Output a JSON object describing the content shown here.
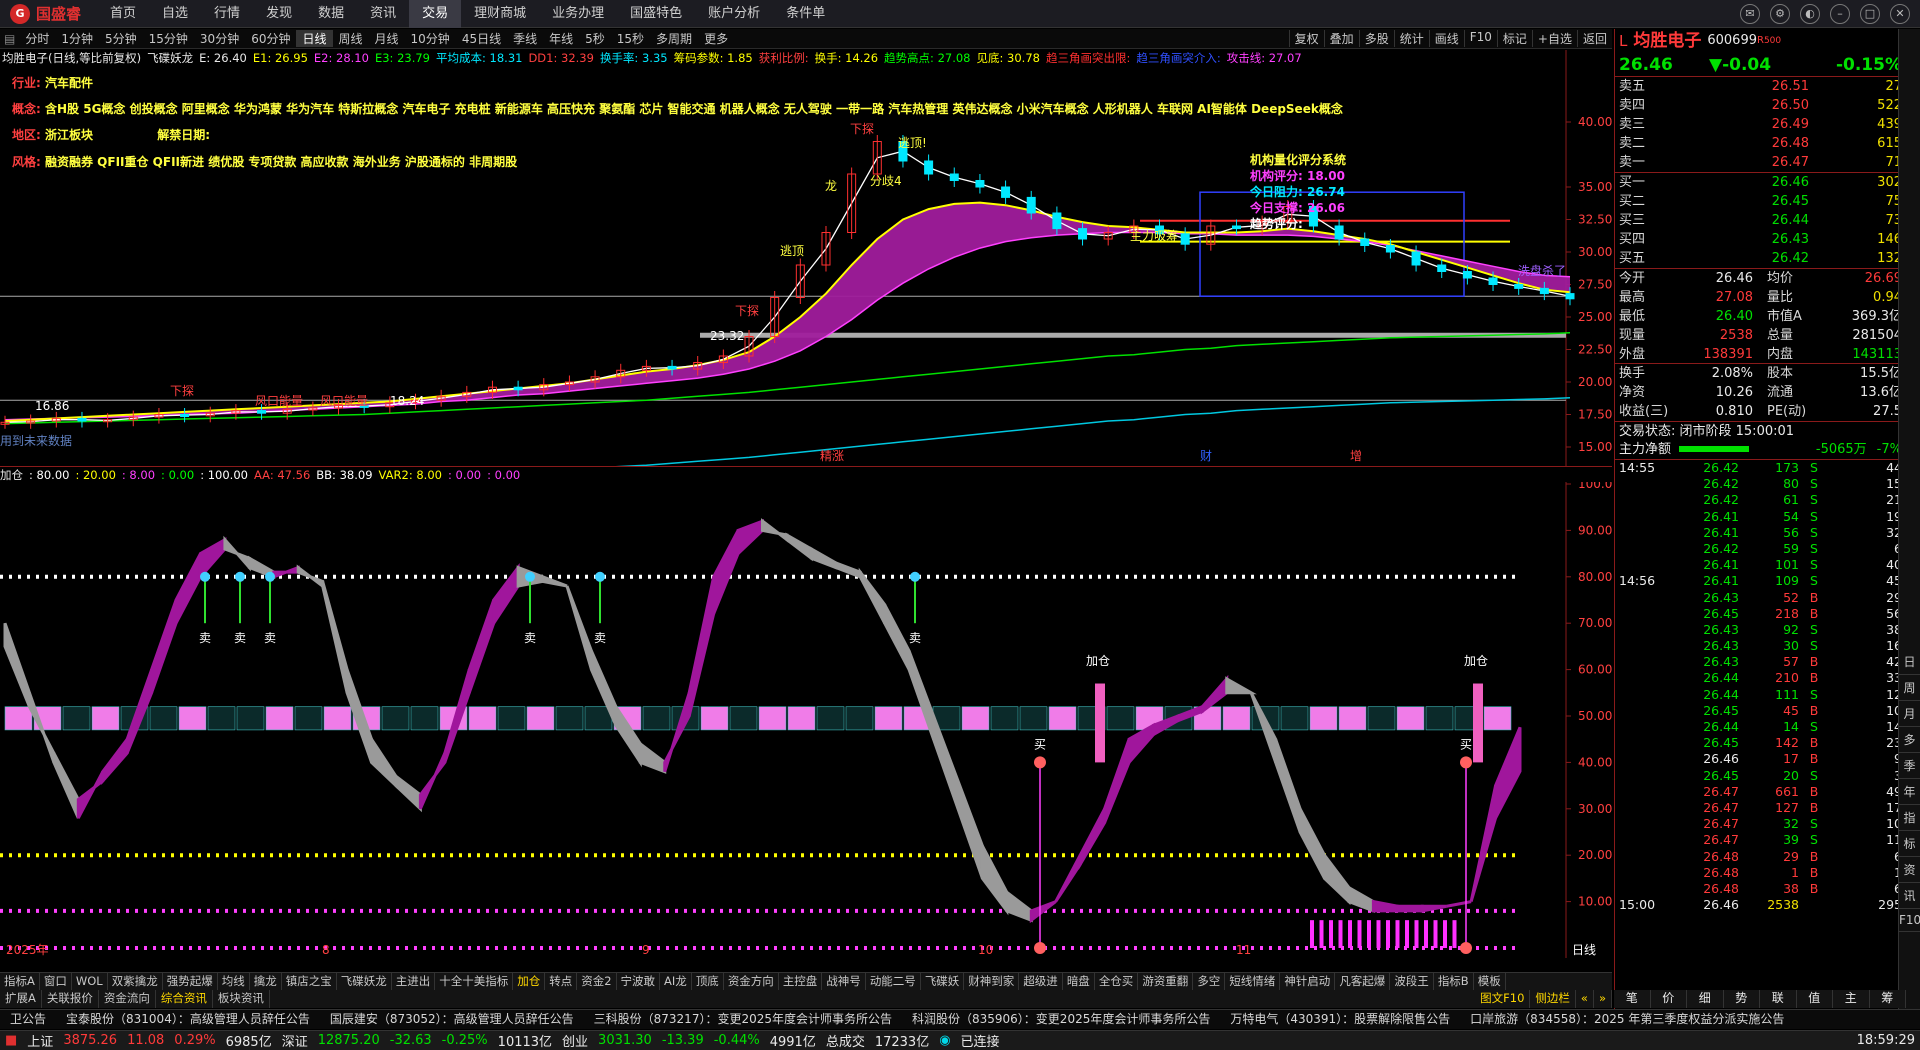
{
  "app": {
    "logo": "国盛睿",
    "logo_mark": "G"
  },
  "menu": [
    "首页",
    "自选",
    "行情",
    "发现",
    "数据",
    "资讯",
    "交易",
    "理财商城",
    "业务办理",
    "国盛特色",
    "账户分析",
    "条件单"
  ],
  "menu_active": 6,
  "periods": [
    "分时",
    "1分钟",
    "5分钟",
    "15分钟",
    "30分钟",
    "60分钟",
    "日线",
    "周线",
    "月线",
    "10分钟",
    "45日线",
    "季线",
    "年线",
    "5秒",
    "15秒",
    "多周期",
    "更多"
  ],
  "period_active": 6,
  "right_tools": [
    "复权",
    "叠加",
    "多股",
    "统计",
    "画线",
    "F10",
    "标记",
    "+自选",
    "返回"
  ],
  "indicator_line": [
    {
      "t": "均胜电子(日线,等比前复权)",
      "c": "#e8e8e8"
    },
    {
      "t": "飞碟妖龙",
      "c": "#e8e8e8"
    },
    {
      "t": "E: 26.40",
      "c": "#e8e8e8"
    },
    {
      "t": "E1: 26.95",
      "c": "#ffff00"
    },
    {
      "t": "E2: 28.10",
      "c": "#ff40ff"
    },
    {
      "t": "E3: 23.79",
      "c": "#00ff00"
    },
    {
      "t": "平均成本: 18.31",
      "c": "#00e8ff"
    },
    {
      "t": "DD1: 32.39",
      "c": "#ff4040"
    },
    {
      "t": "换手率: 3.35",
      "c": "#00e8ff"
    },
    {
      "t": "筹码参数: 1.85",
      "c": "#ffff00"
    },
    {
      "t": "获利比例:",
      "c": "#ff4040"
    },
    {
      "t": "换手: 14.26",
      "c": "#ffff00"
    },
    {
      "t": "趋势高点: 27.08",
      "c": "#00ff00"
    },
    {
      "t": "见底: 30.78",
      "c": "#ffff00"
    },
    {
      "t": "趋三角画突出限:",
      "c": "#ff3030"
    },
    {
      "t": "趋三角画突介入:",
      "c": "#3050ff"
    },
    {
      "t": "攻击线: 27.07",
      "c": "#ff40ff"
    }
  ],
  "info": {
    "industry_label": "行业:",
    "industry": "汽车配件",
    "concept_label": "概念:",
    "concepts": "含H股 5G概念 创投概念 阿里概念 华为鸿蒙 华为汽车 特斯拉概念 汽车电子 充电桩 新能源车 高压快充 聚氨酯 芯片 智能交通 机器人概念 无人驾驶 一带一路 汽车热管理 英伟达概念 小米汽车概念 人形机器人 车联网 AI智能体 DeepSeek概念",
    "region_label": "地区:",
    "region": "浙江板块",
    "unlock_label": "解禁日期:",
    "style_label": "风格:",
    "styles": "融资融券 QFII重仓 QFII新进 绩优股 专项贷款 高应收款 海外业务 沪股通标的 非周期股"
  },
  "quant_box": {
    "title": "机构量化评分系统",
    "rows": [
      "机构评分: 18.00",
      "今日阻力: 26.74",
      "今日支撑: 26.06",
      "趋势评分:"
    ]
  },
  "main_y_labels": [
    "40.00",
    "35.00",
    "32.50",
    "30.00",
    "27.50",
    "25.00",
    "22.50",
    "20.00",
    "17.50",
    "15.00"
  ],
  "main_annotations": [
    "下探",
    "下探",
    "下探",
    "逃顶!",
    "逃顶",
    "龙",
    "分歧4",
    "主力吸筹",
    "洗盘杀了",
    "风口能量",
    "风口能量",
    "18.24",
    "16.86",
    "23.32",
    "用到未来数据",
    "精涨",
    "财",
    "增"
  ],
  "sub_header": [
    {
      "t": "加仓",
      "c": "#e8e8e8"
    },
    {
      "t": ": 80.00",
      "c": "#ffffff"
    },
    {
      "t": ": 20.00",
      "c": "#ffff00"
    },
    {
      "t": ": 8.00",
      "c": "#ff40ff"
    },
    {
      "t": ": 0.00",
      "c": "#00ff00"
    },
    {
      "t": ": 100.00",
      "c": "#ffffff"
    },
    {
      "t": "AA: 47.56",
      "c": "#ff4040"
    },
    {
      "t": "BB: 38.09",
      "c": "#ffffff"
    },
    {
      "t": "VAR2: 8.00",
      "c": "#ffff00"
    },
    {
      "t": ": 0.00",
      "c": "#ff40ff"
    },
    {
      "t": ": 0.00",
      "c": "#ff40ff"
    }
  ],
  "sub_y_labels": [
    "100.0",
    "90.00",
    "80.00",
    "70.00",
    "60.00",
    "50.00",
    "40.00",
    "30.00",
    "20.00",
    "10.00"
  ],
  "sub_annotations": [
    "卖",
    "买",
    "加仓"
  ],
  "x_labels": [
    "2025年",
    "8",
    "9",
    "10",
    "11"
  ],
  "period_label": "日线",
  "chart_data": [
    {
      "type": "candlestick",
      "title": "均胜电子(日线,等比前复权)",
      "ylim": [
        14,
        44
      ],
      "close": [
        16.9,
        17.0,
        17.2,
        17.0,
        17.1,
        17.3,
        17.5,
        17.4,
        17.6,
        17.8,
        17.6,
        17.9,
        18.0,
        18.2,
        18.1,
        18.4,
        18.6,
        18.9,
        19.2,
        19.6,
        19.4,
        19.8,
        20.0,
        20.4,
        20.9,
        21.2,
        21.0,
        21.5,
        22.0,
        23.5,
        26.5,
        29.0,
        31.5,
        36.0,
        38.5,
        37.0,
        36.0,
        35.5,
        35.0,
        34.2,
        33.0,
        31.8,
        31.0,
        31.5,
        32.0,
        31.4,
        30.6,
        32.0,
        31.8,
        32.3,
        33.5,
        32.0,
        31.0,
        30.5,
        30.0,
        29.0,
        28.5,
        28.0,
        27.5,
        27.2,
        26.8,
        26.4
      ],
      "ma_e1": [
        17.0,
        17.1,
        17.2,
        17.3,
        17.4,
        17.5,
        17.6,
        17.7,
        17.8,
        17.9,
        18.0,
        18.1,
        18.2,
        18.3,
        18.4,
        18.5,
        18.7,
        18.9,
        19.1,
        19.3,
        19.5,
        19.7,
        19.9,
        20.2,
        20.5,
        20.8,
        21.0,
        21.3,
        21.7,
        22.3,
        23.5,
        25.0,
        26.8,
        29.0,
        31.0,
        32.5,
        33.3,
        33.7,
        33.8,
        33.6,
        33.2,
        32.7,
        32.3,
        32.0,
        31.9,
        31.7,
        31.5,
        31.5,
        31.5,
        31.6,
        31.8,
        31.6,
        31.3,
        31.0,
        30.6,
        30.0,
        29.4,
        28.8,
        28.2,
        27.6,
        27.1,
        26.9
      ],
      "ma_e2": [
        17.1,
        17.15,
        17.2,
        17.25,
        17.3,
        17.35,
        17.4,
        17.5,
        17.55,
        17.6,
        17.7,
        17.8,
        17.9,
        18.0,
        18.1,
        18.2,
        18.3,
        18.5,
        18.6,
        18.8,
        19.0,
        19.1,
        19.3,
        19.5,
        19.7,
        19.9,
        20.1,
        20.3,
        20.6,
        21.0,
        21.6,
        22.4,
        23.5,
        24.8,
        26.3,
        27.6,
        28.7,
        29.6,
        30.3,
        30.8,
        31.1,
        31.3,
        31.4,
        31.5,
        31.5,
        31.5,
        31.4,
        31.4,
        31.3,
        31.3,
        31.3,
        31.2,
        31.0,
        30.8,
        30.5,
        30.1,
        29.7,
        29.3,
        28.9,
        28.5,
        28.2,
        28.1
      ],
      "ma_e3": [
        16.8,
        16.85,
        16.9,
        16.95,
        17.0,
        17.05,
        17.1,
        17.15,
        17.2,
        17.25,
        17.3,
        17.35,
        17.4,
        17.45,
        17.5,
        17.6,
        17.7,
        17.8,
        17.9,
        18.0,
        18.1,
        18.2,
        18.3,
        18.4,
        18.5,
        18.6,
        18.75,
        18.9,
        19.05,
        19.2,
        19.4,
        19.6,
        19.8,
        20.0,
        20.2,
        20.4,
        20.6,
        20.8,
        21.0,
        21.2,
        21.4,
        21.6,
        21.8,
        22.0,
        22.1,
        22.3,
        22.5,
        22.6,
        22.8,
        22.9,
        23.0,
        23.1,
        23.2,
        23.3,
        23.4,
        23.45,
        23.5,
        23.55,
        23.6,
        23.65,
        23.7,
        23.79
      ]
    },
    {
      "type": "line",
      "title": "加仓",
      "ylim": [
        0,
        100
      ],
      "series": [
        {
          "name": "AA",
          "values": [
            70,
            55,
            40,
            28,
            38,
            45,
            60,
            75,
            85,
            88,
            82,
            80,
            82,
            78,
            55,
            40,
            35,
            30,
            42,
            60,
            75,
            82,
            80,
            78,
            60,
            48,
            40,
            38,
            55,
            80,
            90,
            92,
            88,
            84,
            82,
            80,
            70,
            60,
            45,
            30,
            15,
            8,
            6,
            10,
            20,
            30,
            45,
            48,
            50,
            52,
            58,
            55,
            40,
            25,
            15,
            10,
            8,
            8,
            8,
            9,
            10,
            35,
            47.56
          ]
        },
        {
          "name": "BB",
          "values": [
            65,
            52,
            42,
            32,
            36,
            42,
            55,
            70,
            80,
            86,
            84,
            81,
            81,
            79,
            60,
            45,
            37,
            33,
            40,
            55,
            70,
            78,
            79,
            78,
            64,
            52,
            44,
            40,
            50,
            72,
            85,
            90,
            89,
            86,
            83,
            81,
            74,
            64,
            50,
            36,
            22,
            12,
            8,
            10,
            18,
            27,
            40,
            46,
            49,
            51,
            55,
            55,
            45,
            30,
            20,
            13,
            10,
            9,
            9,
            9,
            10,
            28,
            38.09
          ]
        }
      ]
    }
  ],
  "quote": {
    "code_prefix": "L",
    "name": "均胜电子",
    "code": "600699",
    "flag": "R",
    "flag2": "500",
    "price": "26.46",
    "change": "▼-0.04",
    "pct": "-0.15%",
    "asks": [
      {
        "l": "卖五",
        "p": "26.51",
        "v": "27"
      },
      {
        "l": "卖四",
        "p": "26.50",
        "v": "522"
      },
      {
        "l": "卖三",
        "p": "26.49",
        "v": "439"
      },
      {
        "l": "卖二",
        "p": "26.48",
        "v": "615"
      },
      {
        "l": "卖一",
        "p": "26.47",
        "v": "71"
      }
    ],
    "bids": [
      {
        "l": "买一",
        "p": "26.46",
        "v": "302"
      },
      {
        "l": "买二",
        "p": "26.45",
        "v": "75"
      },
      {
        "l": "买三",
        "p": "26.44",
        "v": "73"
      },
      {
        "l": "买四",
        "p": "26.43",
        "v": "146"
      },
      {
        "l": "买五",
        "p": "26.42",
        "v": "132"
      }
    ],
    "stats": [
      {
        "a": "今开",
        "av": "26.46",
        "ac": "wht",
        "b": "均价",
        "bv": "26.69",
        "bc": "up"
      },
      {
        "a": "最高",
        "av": "27.08",
        "ac": "up",
        "b": "量比",
        "bv": "0.94",
        "bc": "yel"
      },
      {
        "a": "最低",
        "av": "26.40",
        "ac": "dn",
        "b": "市值A",
        "bv": "369.3亿",
        "bc": "wht"
      },
      {
        "a": "现量",
        "av": "2538",
        "ac": "up",
        "b": "总量",
        "bv": "281504",
        "bc": "wht"
      },
      {
        "a": "外盘",
        "av": "138391",
        "ac": "up",
        "b": "内盘",
        "bv": "143113",
        "bc": "dn"
      },
      {
        "a": "换手",
        "av": "2.08%",
        "ac": "wht",
        "b": "股本",
        "bv": "15.5亿",
        "bc": "wht"
      },
      {
        "a": "净资",
        "av": "10.26",
        "ac": "wht",
        "b": "流通",
        "bv": "13.6亿",
        "bc": "wht"
      },
      {
        "a": "收益(三)",
        "av": "0.810",
        "ac": "wht",
        "b": "PE(动)",
        "bv": "27.5",
        "bc": "wht"
      }
    ],
    "trade_status": "交易状态: 闭市阶段 15:00:01",
    "net_label": "主力净额",
    "net_value": "-5065万",
    "net_pct": "-7%",
    "ticks": [
      {
        "t": "14:55",
        "p": "26.42",
        "v": "173",
        "s": "S",
        "n": "44"
      },
      {
        "t": "",
        "p": "26.42",
        "v": "80",
        "s": "S",
        "n": "15"
      },
      {
        "t": "",
        "p": "26.42",
        "v": "61",
        "s": "S",
        "n": "21"
      },
      {
        "t": "",
        "p": "26.41",
        "v": "54",
        "s": "S",
        "n": "19"
      },
      {
        "t": "",
        "p": "26.41",
        "v": "56",
        "s": "S",
        "n": "32"
      },
      {
        "t": "",
        "p": "26.42",
        "v": "59",
        "s": "S",
        "n": "6"
      },
      {
        "t": "",
        "p": "26.41",
        "v": "101",
        "s": "S",
        "n": "40"
      },
      {
        "t": "14:56",
        "p": "26.41",
        "v": "109",
        "s": "S",
        "n": "45"
      },
      {
        "t": "",
        "p": "26.43",
        "v": "52",
        "s": "B",
        "n": "29"
      },
      {
        "t": "",
        "p": "26.45",
        "v": "218",
        "s": "B",
        "n": "56"
      },
      {
        "t": "",
        "p": "26.43",
        "v": "92",
        "s": "S",
        "n": "38"
      },
      {
        "t": "",
        "p": "26.43",
        "v": "30",
        "s": "S",
        "n": "16"
      },
      {
        "t": "",
        "p": "26.43",
        "v": "57",
        "s": "B",
        "n": "42"
      },
      {
        "t": "",
        "p": "26.44",
        "v": "210",
        "s": "B",
        "n": "33"
      },
      {
        "t": "",
        "p": "26.44",
        "v": "111",
        "s": "S",
        "n": "12"
      },
      {
        "t": "",
        "p": "26.45",
        "v": "45",
        "s": "B",
        "n": "10"
      },
      {
        "t": "",
        "p": "26.44",
        "v": "14",
        "s": "S",
        "n": "14"
      },
      {
        "t": "",
        "p": "26.45",
        "v": "142",
        "s": "B",
        "n": "23"
      },
      {
        "t": "",
        "p": "26.46",
        "v": "17",
        "s": "B",
        "n": "9"
      },
      {
        "t": "",
        "p": "26.45",
        "v": "20",
        "s": "S",
        "n": "3"
      },
      {
        "t": "",
        "p": "26.47",
        "v": "661",
        "s": "B",
        "n": "49"
      },
      {
        "t": "",
        "p": "26.47",
        "v": "127",
        "s": "B",
        "n": "17"
      },
      {
        "t": "",
        "p": "26.47",
        "v": "32",
        "s": "S",
        "n": "10"
      },
      {
        "t": "",
        "p": "26.47",
        "v": "39",
        "s": "S",
        "n": "11"
      },
      {
        "t": "",
        "p": "26.48",
        "v": "29",
        "s": "B",
        "n": "6"
      },
      {
        "t": "",
        "p": "26.48",
        "v": "1",
        "s": "B",
        "n": "1"
      },
      {
        "t": "",
        "p": "26.48",
        "v": "38",
        "s": "B",
        "n": "6"
      },
      {
        "t": "15:00",
        "p": "26.46",
        "v": "2538",
        "s": "",
        "n": "295"
      }
    ]
  },
  "vertical_tabs": [
    "日",
    "周",
    "月",
    "多",
    "季",
    "年",
    "指",
    "标",
    "资",
    "讯",
    "F10"
  ],
  "bottom_tabs": [
    "指标A",
    "窗口",
    "WOL",
    "双紫擒龙",
    "强势起爆",
    "均线",
    "擒龙",
    "镇店之宝",
    "飞碟妖龙",
    "主进出",
    "十全十美指标",
    "加仓",
    "转点",
    "资金2",
    "宁波敢",
    "AI龙",
    "顶底",
    "资金方向",
    "主控盘",
    "战神号",
    "动能二号",
    "飞碟妖",
    "财神到家",
    "超级进",
    "暗盘",
    "全仓买",
    "游资重翻",
    "多空",
    "短线情绪",
    "神针启动",
    "凡客起爆",
    "波段王",
    "指标B",
    "模板"
  ],
  "bottom_tab_active": 11,
  "bottom_tabs2": [
    "扩展A",
    "关联报价",
    "资金流向",
    "综合资讯",
    "板块资讯"
  ],
  "bottom_tab2_active": 3,
  "bottom_right": [
    "图文F10",
    "侧边栏",
    "«",
    "»"
  ],
  "right_bottom_tabs": [
    "笔",
    "价",
    "细",
    "势",
    "联",
    "值",
    "主",
    "筹"
  ],
  "news": [
    "卫公告",
    "宝泰股份（831004）：高级管理人员辞任公告",
    "国辰建安（873052）：高级管理人员辞任公告",
    "三科股份（873217）：变更2025年度会计师事务所公告",
    "科润股份（835906）：变更2025年度会计师事务所公告",
    "万特电气（430391）：股票解除限售公告",
    "口岸旅游（834558）：2025 年第三季度权益分派实施公告"
  ],
  "status": {
    "sh_label": "上证",
    "sh": "3875.26",
    "sh_chg": "11.08",
    "sh_pct": "0.29%",
    "sh_amt": "6985亿",
    "sz_label": "深证",
    "sz": "12875.20",
    "sz_chg": "-32.63",
    "sz_pct": "-0.25%",
    "sz_amt": "10113亿",
    "cy_label": "创业",
    "cy": "3031.30",
    "cy_chg": "-13.39",
    "cy_pct": "-0.44%",
    "cy_amt": "4991亿",
    "total_label": "总成交",
    "total": "17233亿",
    "conn": "已连接",
    "time": "18:59:29"
  },
  "colors": {
    "up": "#ff3a3a",
    "down": "#00e000",
    "bg": "#000000",
    "accent": "#b8168c"
  }
}
